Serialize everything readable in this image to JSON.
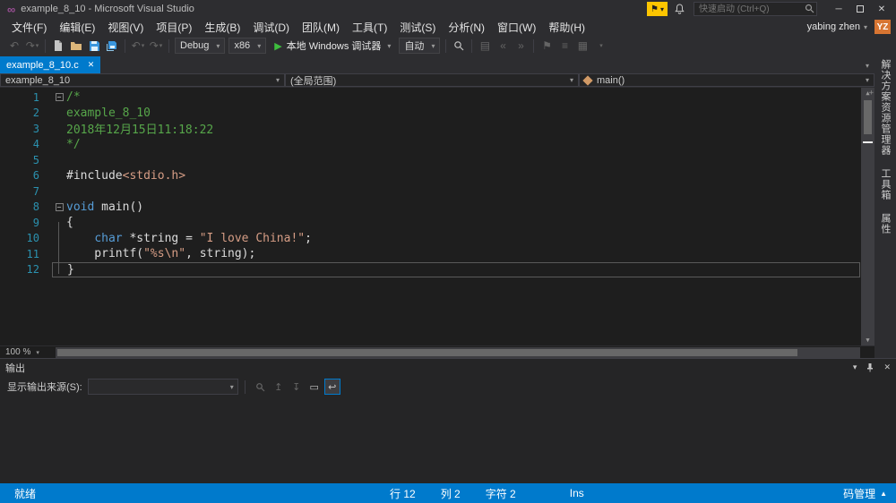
{
  "window": {
    "title": "example_8_10 - Microsoft Visual Studio"
  },
  "title_bar": {
    "quick_launch_placeholder": "快速启动 (Ctrl+Q)"
  },
  "menu": {
    "items": [
      "文件(F)",
      "编辑(E)",
      "视图(V)",
      "项目(P)",
      "生成(B)",
      "调试(D)",
      "团队(M)",
      "工具(T)",
      "测试(S)",
      "分析(N)",
      "窗口(W)",
      "帮助(H)"
    ],
    "user": "yabing zhen",
    "avatar": "YZ"
  },
  "toolbar": {
    "configuration": "Debug",
    "platform": "x86",
    "debug_button": "本地 Windows 调试器",
    "watch_mode": "自动"
  },
  "tab_strip": {
    "active_tab": "example_8_10.c"
  },
  "nav_bar": {
    "project": "example_8_10",
    "scope": "(全局范围)",
    "member": "main()"
  },
  "editor": {
    "zoom": "100 %",
    "lines": [
      {
        "n": 1,
        "fold": true,
        "tokens": [
          {
            "c": "cm",
            "t": "/*"
          }
        ]
      },
      {
        "n": 2,
        "tokens": [
          {
            "c": "cm",
            "t": "example_8_10"
          }
        ]
      },
      {
        "n": 3,
        "tokens": [
          {
            "c": "cm",
            "t": "2018年12月15日11:18:22"
          }
        ]
      },
      {
        "n": 4,
        "tokens": [
          {
            "c": "cm",
            "t": "*/"
          }
        ]
      },
      {
        "n": 5,
        "tokens": []
      },
      {
        "n": 6,
        "tokens": [
          {
            "c": "pl",
            "t": "#include"
          },
          {
            "c": "str",
            "t": "<stdio.h>"
          }
        ]
      },
      {
        "n": 7,
        "tokens": []
      },
      {
        "n": 8,
        "fold": true,
        "tokens": [
          {
            "c": "kw",
            "t": "void"
          },
          {
            "c": "pl",
            "t": " main()"
          }
        ]
      },
      {
        "n": 9,
        "tokens": [
          {
            "c": "pl",
            "t": "{"
          }
        ]
      },
      {
        "n": 10,
        "tokens": [
          {
            "c": "pl",
            "t": "    "
          },
          {
            "c": "kw",
            "t": "char"
          },
          {
            "c": "pl",
            "t": " *string = "
          },
          {
            "c": "str",
            "t": "\"I love China!\""
          },
          {
            "c": "pl",
            "t": ";"
          }
        ]
      },
      {
        "n": 11,
        "tokens": [
          {
            "c": "pl",
            "t": "    printf("
          },
          {
            "c": "str",
            "t": "\"%s\\n\""
          },
          {
            "c": "pl",
            "t": ", string);"
          }
        ]
      },
      {
        "n": 12,
        "current": true,
        "tokens": [
          {
            "c": "pl",
            "t": "}"
          }
        ]
      }
    ]
  },
  "side_tabs": [
    "解决方案资源管理器",
    "工具箱",
    "属性"
  ],
  "output_panel": {
    "title": "输出",
    "source_label": "显示输出来源(S):"
  },
  "status_bar": {
    "state": "就绪",
    "line": "行 12",
    "column": "列 2",
    "character": "字符 2",
    "insert_mode": "Ins",
    "source_control": "码管理"
  },
  "icons": {
    "logo": "∞",
    "flag": "⚑",
    "caret_down": "▾",
    "caret_up": "▲",
    "close": "✕",
    "minimize": "─",
    "back": "↶",
    "forward": "↷",
    "undo": "↶",
    "redo": "↷",
    "run": "▶",
    "fold_collapse": "−",
    "scroll_up": "▲",
    "scroll_down": "▼",
    "split": "+",
    "outline": "▤",
    "indent_decrease": "«",
    "indent_increase": "»",
    "bookmark": "⚑",
    "list": "≡",
    "grid": "▦",
    "prev_message": "↥",
    "next_message": "↧",
    "clear_all": "▭",
    "word_wrap": "↩"
  },
  "colors": {
    "accent": "#007acc",
    "comment": "#57a64a",
    "keyword": "#569cd6",
    "string": "#d69d85",
    "line_number": "#2b91af",
    "editor_bg": "#1e1e1e",
    "chrome_bg": "#2d2d30",
    "flag_bg": "#fdc500",
    "avatar_bg": "#d77532"
  }
}
